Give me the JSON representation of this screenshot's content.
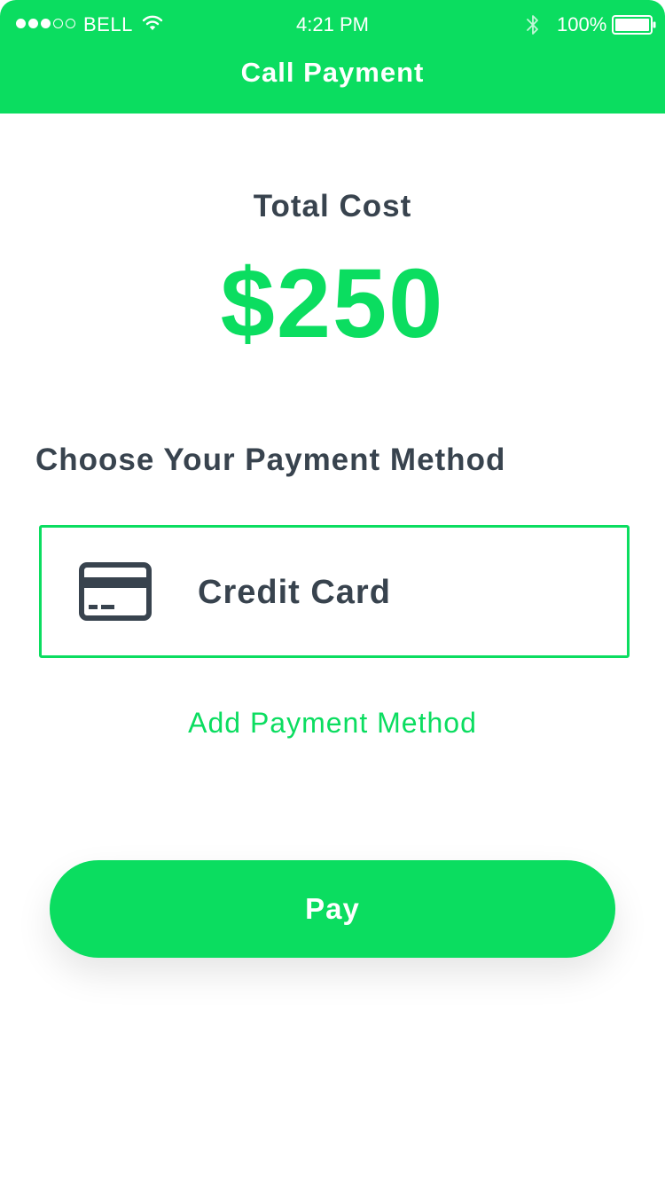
{
  "status_bar": {
    "carrier": "BELL",
    "time": "4:21 PM",
    "battery_percent": "100%",
    "signal_bars_filled": 3,
    "signal_bars_total": 5,
    "icons": [
      "wifi-icon",
      "bluetooth-icon",
      "battery-icon"
    ]
  },
  "header": {
    "title": "Call Payment"
  },
  "summary": {
    "label": "Total Cost",
    "amount": "$250"
  },
  "payment": {
    "section_title": "Choose Your Payment Method",
    "methods": [
      {
        "label": "Credit Card",
        "icon": "credit-card-icon",
        "selected": true
      }
    ],
    "add_method_label": "Add Payment Method"
  },
  "actions": {
    "pay_label": "Pay"
  },
  "colors": {
    "accent": "#0bdd60",
    "text_dark": "#38434e",
    "background": "#ffffff"
  }
}
